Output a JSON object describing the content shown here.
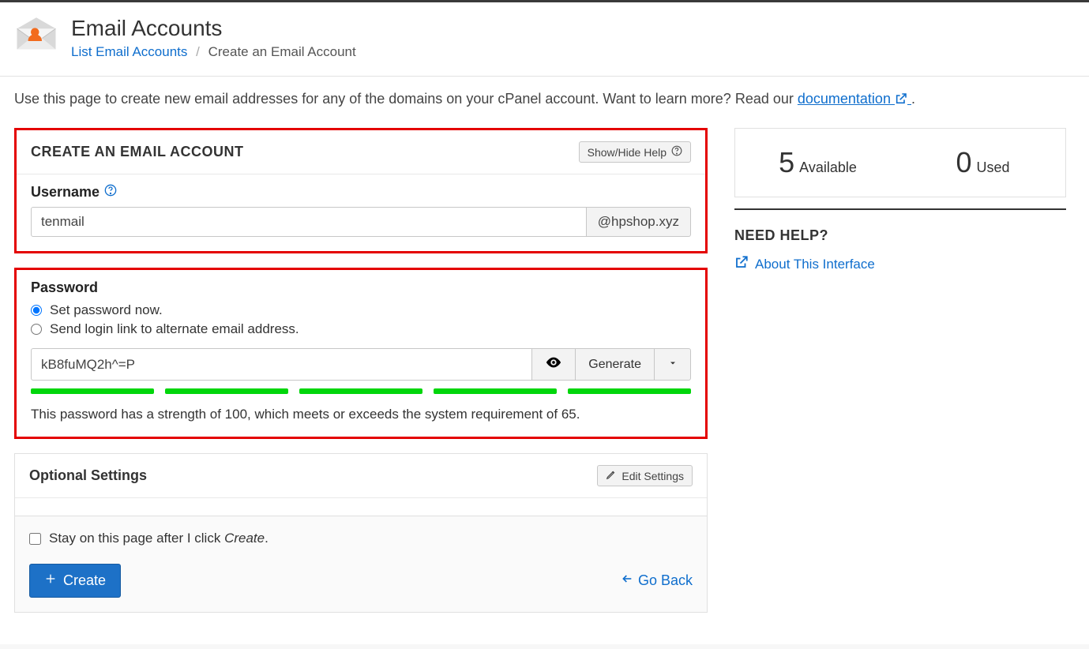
{
  "header": {
    "title": "Email Accounts",
    "breadcrumb_link": "List Email Accounts",
    "breadcrumb_current": "Create an Email Account"
  },
  "intro": {
    "text_before": "Use this page to create new email addresses for any of the domains on your cPanel account. Want to learn more? Read our ",
    "link": "documentation",
    "text_after": " ."
  },
  "create_section": {
    "title": "CREATE AN EMAIL ACCOUNT",
    "help_button": "Show/Hide Help",
    "username_label": "Username",
    "username_value": "tenmail",
    "domain_addon": "@hpshop.xyz"
  },
  "password_section": {
    "title": "Password",
    "option_now": "Set password now.",
    "option_email": "Send login link to alternate email address.",
    "password_value": "kB8fuMQ2h^=P",
    "generate": "Generate",
    "strength_msg": "This password has a strength of 100, which meets or exceeds the system requirement of 65."
  },
  "optional": {
    "title": "Optional Settings",
    "edit_button": "Edit Settings"
  },
  "footer": {
    "stay_label_before": "Stay on this page after I click ",
    "stay_label_em": "Create",
    "stay_label_after": ".",
    "create_button": "Create",
    "go_back": "Go Back"
  },
  "side": {
    "available_count": "5",
    "available_label": "Available",
    "used_count": "0",
    "used_label": "Used",
    "need_help": "NEED HELP?",
    "about_link": "About This Interface"
  }
}
